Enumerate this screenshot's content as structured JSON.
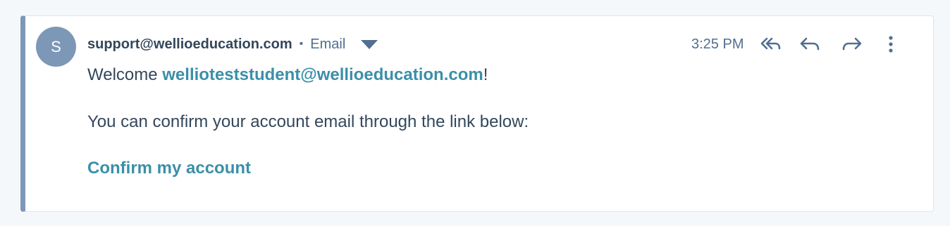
{
  "email": {
    "avatar_initial": "S",
    "sender": "support@wellioeducation.com",
    "separator": "•",
    "channel": "Email",
    "time": "3:25 PM",
    "greeting_prefix": "Welcome ",
    "recipient_link": "wellioteststudent@wellioeducation.com",
    "greeting_suffix": "!",
    "body_line": "You can confirm your account email through the link below:",
    "confirm_link": "Confirm my account"
  },
  "actions": {
    "icons": [
      "reply-all-icon",
      "reply-icon",
      "forward-icon",
      "more-vertical-icon"
    ]
  },
  "colors": {
    "accent_border": "#7c98b6",
    "link": "#3b8fa9",
    "text": "#33475b",
    "muted": "#516f90"
  }
}
